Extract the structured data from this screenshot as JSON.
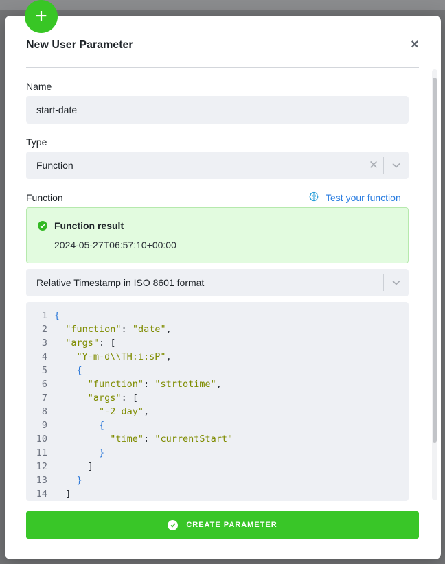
{
  "modal": {
    "title": "New User Parameter",
    "close_label": "×",
    "add_glyph": "+"
  },
  "name_field": {
    "label": "Name",
    "value": "start-date"
  },
  "type_field": {
    "label": "Type",
    "value": "Function",
    "clear_glyph": "✕"
  },
  "function_field": {
    "label": "Function",
    "test_link": "Test your function",
    "test_icon": "brain-icon"
  },
  "result": {
    "title": "Function result",
    "value": "2024-05-27T06:57:10+00:00",
    "icon": "check-circle-icon"
  },
  "preset_select": {
    "value": "Relative Timestamp in ISO 8601 format"
  },
  "code": {
    "line_numbers": [
      "1",
      "2",
      "3",
      "4",
      "5",
      "6",
      "7",
      "8",
      "9",
      "10",
      "11",
      "12",
      "13",
      "14"
    ],
    "lines": [
      "{",
      "  \"function\": \"date\",",
      "  \"args\": [",
      "    \"Y-m-d\\\\TH:i:sP\",",
      "    {",
      "      \"function\": \"strtotime\",",
      "      \"args\": [",
      "        \"-2 day\",",
      "        {",
      "          \"time\": \"currentStart\"",
      "        }",
      "      ]",
      "    }",
      "  ]"
    ]
  },
  "footer": {
    "create_label": "CREATE PARAMETER"
  },
  "colors": {
    "accent_green": "#39c628",
    "link_blue": "#2a7de1",
    "result_bg": "#e2fbdf"
  }
}
